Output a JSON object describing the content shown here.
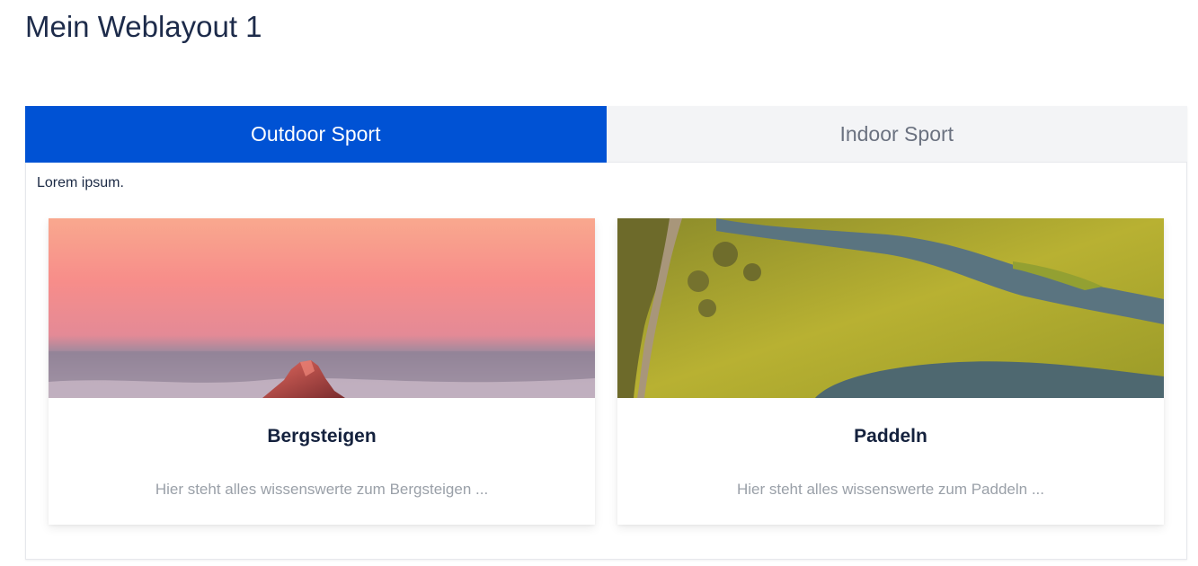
{
  "page": {
    "title": "Mein Weblayout 1"
  },
  "tabs": [
    {
      "label": "Outdoor Sport",
      "active": true
    },
    {
      "label": "Indoor Sport",
      "active": false
    }
  ],
  "tab_content": {
    "intro": "Lorem ipsum.",
    "cards": [
      {
        "image": "mountain-peak-sunset-photo",
        "title": "Bergsteigen",
        "text": "Hier steht alles wissenswerte zum Bergsteigen ..."
      },
      {
        "image": "river-wetland-aerial-photo",
        "title": "Paddeln",
        "text": "Hier steht alles wissenswerte zum Paddeln ..."
      }
    ]
  },
  "colors": {
    "accent": "#0052d4",
    "title_text": "#1d2b4a",
    "muted_text": "#9aa0a8",
    "inactive_tab_bg": "#f3f4f6"
  }
}
